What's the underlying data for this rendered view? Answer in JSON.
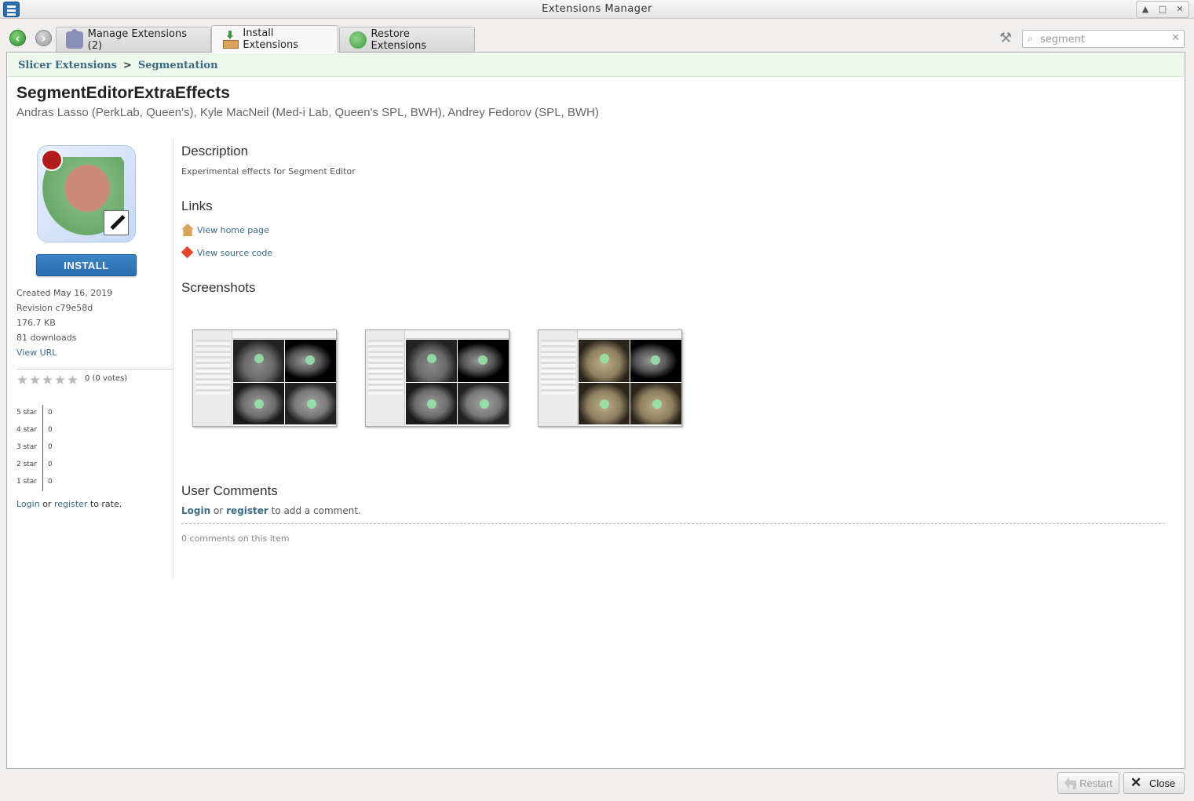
{
  "window": {
    "title": "Extensions Manager",
    "controls": [
      "▲",
      "□",
      "✕"
    ]
  },
  "toolbar": {
    "back_icon": "back-arrow-icon",
    "forward_icon": "forward-arrow-icon",
    "tabs": [
      {
        "label": "Manage Extensions (2)",
        "icon": "puzzle-icon",
        "active": false
      },
      {
        "label": "Install Extensions",
        "icon": "install-box-icon",
        "active": true
      },
      {
        "label": "Restore Extensions",
        "icon": "restore-icon",
        "active": false
      }
    ],
    "search": {
      "value": "segment",
      "placeholder": ""
    }
  },
  "breadcrumb": {
    "root": "Slicer Extensions",
    "separator": ">",
    "current": "Segmentation"
  },
  "extension": {
    "name": "SegmentEditorExtraEffects",
    "authors": "Andras Lasso (PerkLab, Queen's), Kyle MacNeil (Med-i Lab, Queen's SPL, BWH), Andrey Fedorov (SPL, BWH)",
    "install_label": "INSTALL",
    "created": "Created May 16, 2019",
    "revision": "Revision c79e58d",
    "size": "176.7 KB",
    "downloads": "81 downloads",
    "view_url": "View URL",
    "rating_summary": "0 (0 votes)",
    "rating_histogram": [
      {
        "label": "5 star",
        "count": "0"
      },
      {
        "label": "4 star",
        "count": "0"
      },
      {
        "label": "3 star",
        "count": "0"
      },
      {
        "label": "2 star",
        "count": "0"
      },
      {
        "label": "1 star",
        "count": "0"
      }
    ],
    "rate_login": {
      "login": "Login",
      "or": "or",
      "register": "register",
      "suffix": "to rate."
    }
  },
  "sections": {
    "description_title": "Description",
    "description_text": "Experimental effects for Segment Editor",
    "links_title": "Links",
    "links": [
      {
        "label": "View home page",
        "icon": "home-icon"
      },
      {
        "label": "View source code",
        "icon": "git-icon"
      }
    ],
    "screenshots_title": "Screenshots",
    "comments_title": "User Comments",
    "comment_login": {
      "login": "Login",
      "or": "or",
      "register": "register",
      "suffix": "to add a comment."
    },
    "comment_count": "0 comments on this item"
  },
  "footer": {
    "restart_label": "Restart",
    "close_label": "Close"
  },
  "colors": {
    "accent": "#3b6b82",
    "install_button": "#2a6db0",
    "breadcrumb_bg": "#eef7ee"
  }
}
